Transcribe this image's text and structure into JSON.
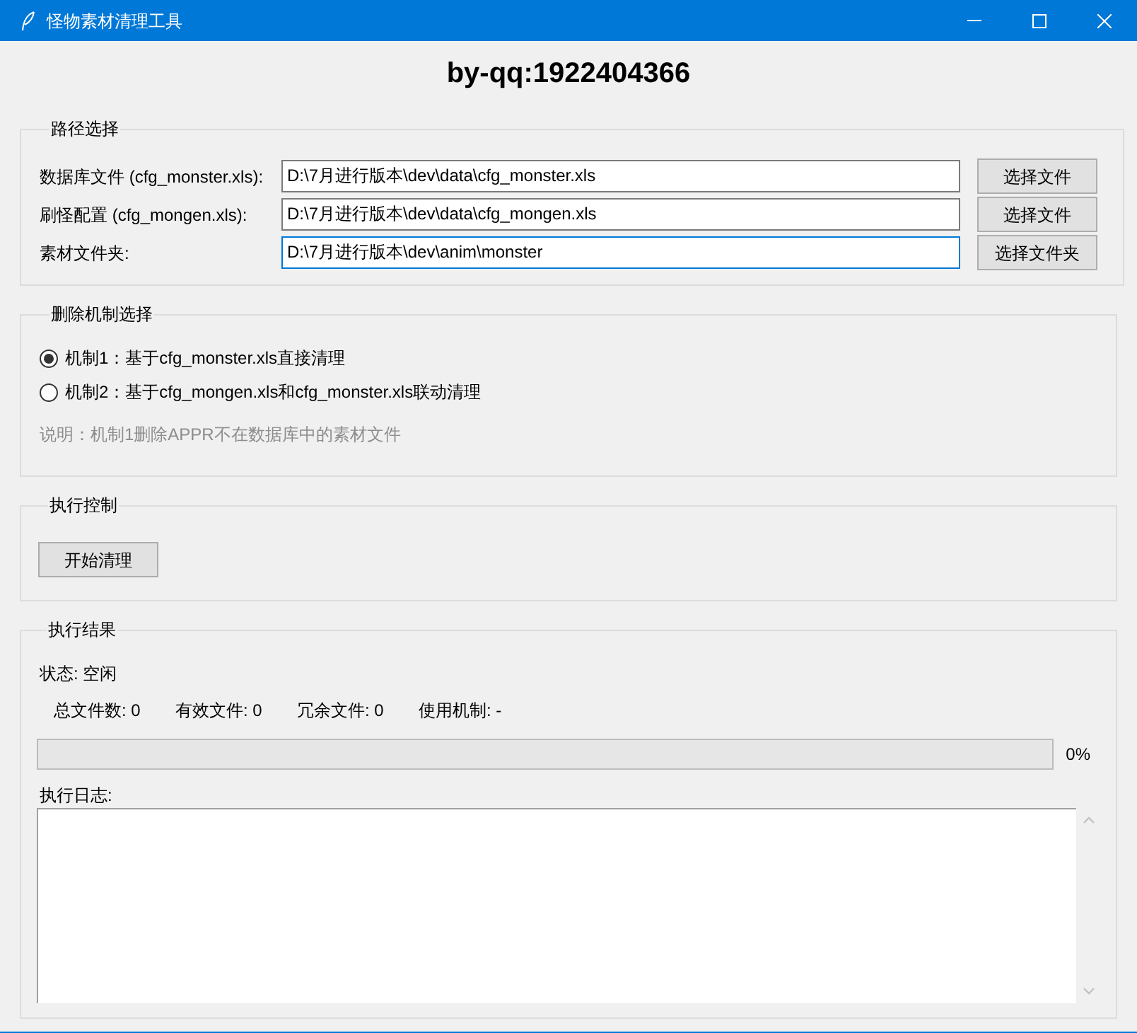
{
  "window": {
    "title": "怪物素材清理工具"
  },
  "header": "by-qq:1922404366",
  "path_group": {
    "title": "路径选择",
    "rows": [
      {
        "label": "数据库文件 (cfg_monster.xls):",
        "value": "D:\\7月进行版本\\dev\\data\\cfg_monster.xls",
        "button": "选择文件",
        "focused": false
      },
      {
        "label": "刷怪配置 (cfg_mongen.xls):",
        "value": "D:\\7月进行版本\\dev\\data\\cfg_mongen.xls",
        "button": "选择文件",
        "focused": false
      },
      {
        "label": "素材文件夹:",
        "value": "D:\\7月进行版本\\dev\\anim\\monster",
        "button": "选择文件夹",
        "focused": true
      }
    ]
  },
  "mode_group": {
    "title": "删除机制选择",
    "options": [
      {
        "label": "机制1：基于cfg_monster.xls直接清理",
        "selected": true
      },
      {
        "label": "机制2：基于cfg_mongen.xls和cfg_monster.xls联动清理",
        "selected": false
      }
    ],
    "note": "说明：机制1删除APPR不在数据库中的素材文件"
  },
  "control_group": {
    "title": "执行控制",
    "button": "开始清理"
  },
  "result_group": {
    "title": "执行结果",
    "status": "状态: 空闲",
    "stats": [
      "总文件数: 0",
      "有效文件: 0",
      "冗余文件: 0",
      "使用机制: -"
    ],
    "progress": {
      "level": 0,
      "reading": "0%"
    },
    "log_label": "执行日志:"
  }
}
